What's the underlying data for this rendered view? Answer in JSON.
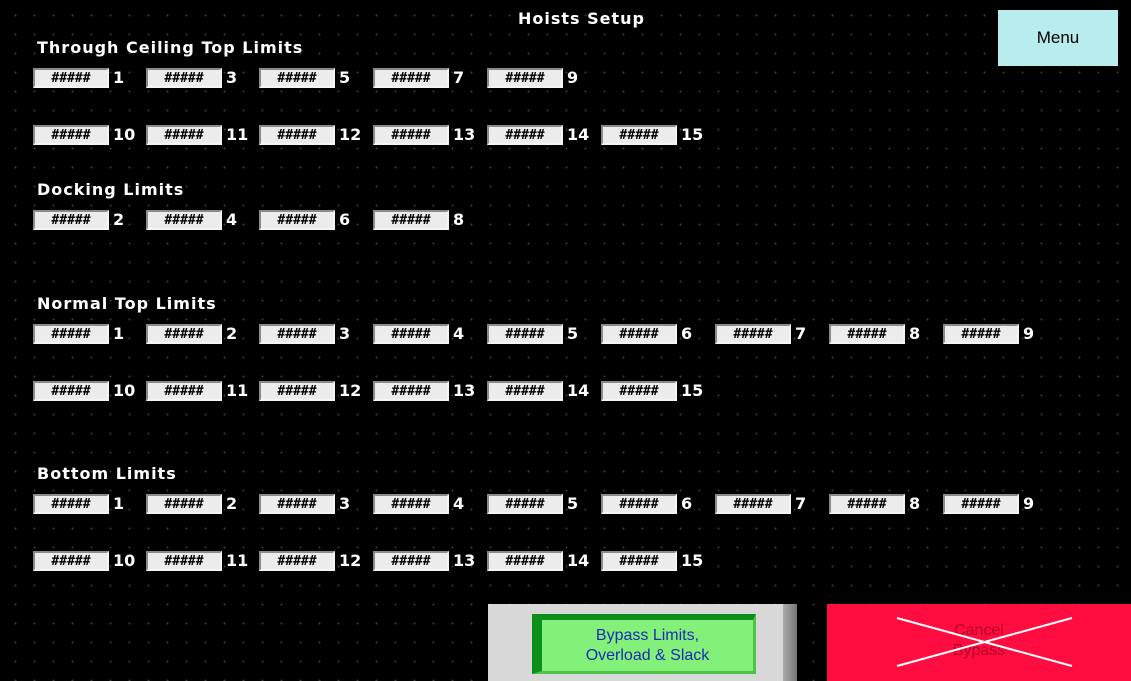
{
  "title": "Hoists Setup",
  "menu_label": "Menu",
  "placeholder": "#####",
  "sections": {
    "ceiling": {
      "label": "Through Ceiling Top Limits",
      "row1": [
        "1",
        "3",
        "5",
        "7",
        "9"
      ],
      "row2": [
        "10",
        "11",
        "12",
        "13",
        "14",
        "15"
      ]
    },
    "docking": {
      "label": "Docking Limits",
      "row1": [
        "2",
        "4",
        "6",
        "8"
      ]
    },
    "normal": {
      "label": "Normal Top Limits",
      "row1": [
        "1",
        "2",
        "3",
        "4",
        "5",
        "6",
        "7",
        "8",
        "9"
      ],
      "row2": [
        "10",
        "11",
        "12",
        "13",
        "14",
        "15"
      ]
    },
    "bottom": {
      "label": "Bottom Limits",
      "row1": [
        "1",
        "2",
        "3",
        "4",
        "5",
        "6",
        "7",
        "8",
        "9"
      ],
      "row2": [
        "10",
        "11",
        "12",
        "13",
        "14",
        "15"
      ]
    }
  },
  "bypass": {
    "line1": "Bypass Limits,",
    "line2": "Overload & Slack"
  },
  "cancel": {
    "line1": "Cancel",
    "line2": "Bypass"
  },
  "colors": {
    "menu_bg": "#b9ecef",
    "bypass_bg": "#83f07a",
    "cancel_bg": "#ff0d40"
  }
}
